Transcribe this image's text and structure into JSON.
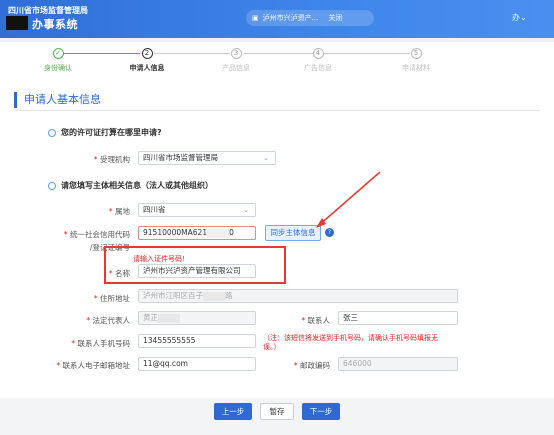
{
  "header": {
    "line1": "四川省市场监督管理局",
    "line2": "办事系统",
    "tab_label": "泸州市兴泸资产...",
    "tab_close": "关闭",
    "user": "办"
  },
  "steps": [
    {
      "num": "✓",
      "label": "身份确认"
    },
    {
      "num": "2",
      "label": "申请人信息"
    },
    {
      "num": "3",
      "label": "产品信息"
    },
    {
      "num": "4",
      "label": "广告信息"
    },
    {
      "num": "5",
      "label": "申请材料"
    }
  ],
  "section_title": "申请人基本信息",
  "q1": "您的许可证打算在哪里申请?",
  "q2": "请您填写主体相关信息（法人或其他组织）",
  "form": {
    "agency_label": "受理机构",
    "agency_value": "四川省市场监督管理局",
    "region_label": "属地",
    "region_value": "四川省",
    "credit_label": "统一社会信用代码",
    "credit_label2": "/登记证编号",
    "credit_value_a": "91510000MA621",
    "credit_value_b": "0",
    "sync_button": "同步主体信息",
    "help": "?",
    "error_msg": "请输入证件号码!",
    "name_label": "名称",
    "name_value": "泸州市兴泸资产管理有限公司",
    "address_label": "住所地址",
    "address_value_a": "泸州市江阳区百子",
    "address_value_b": "路",
    "legal_label": "法定代表人",
    "legal_value": "黄正",
    "contact_label": "联系人",
    "contact_value": "张三",
    "phone_label": "联系人手机号码",
    "phone_value": "13455555555",
    "phone_warning": "（注：该短信将发送到手机号码，请确认手机号码填报无误。）",
    "email_label": "联系人电子邮箱地址",
    "email_value": "11@qq.com",
    "postcode_label": "邮政编码",
    "postcode_value": "646000"
  },
  "buttons": {
    "prev": "上一步",
    "save": "暂存",
    "next": "下一步"
  }
}
